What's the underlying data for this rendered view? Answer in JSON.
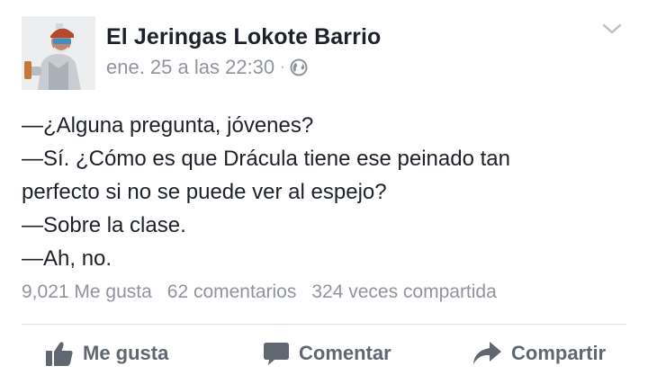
{
  "post": {
    "author": "El Jeringas Lokote Barrio",
    "timestamp": "ene. 25 a las 22:30",
    "separator": "·",
    "privacy_icon": "globe-icon",
    "menu_icon": "chevron-down-icon",
    "body_lines": [
      "—¿Alguna pregunta, jóvenes?",
      "—Sí. ¿Cómo es que Drácula tiene ese peinado tan",
      "perfecto si no se puede ver al espejo?",
      "—Sobre la clase.",
      "—Ah, no."
    ]
  },
  "stats": {
    "likes": "9,021 Me gusta",
    "comments": "62 comentarios",
    "shares": "324 veces compartida"
  },
  "actions": {
    "like": "Me gusta",
    "comment": "Comentar",
    "share": "Compartir"
  },
  "colors": {
    "primary_text": "#1d2129",
    "secondary_text": "#90949c",
    "action_text": "#606770",
    "divider": "#dddfe2"
  }
}
